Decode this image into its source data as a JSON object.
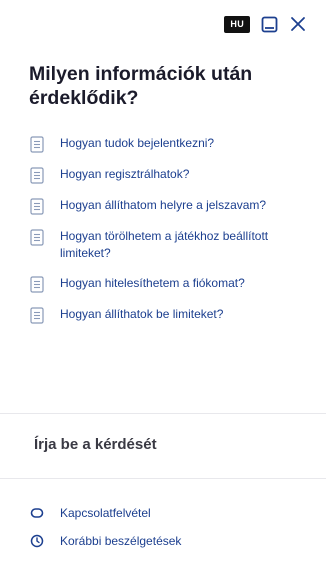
{
  "header": {
    "language_badge": "HU"
  },
  "main": {
    "heading": "Milyen információk után érdeklődik?",
    "faq_items": [
      {
        "label": "Hogyan tudok bejelentkezni?"
      },
      {
        "label": "Hogyan regisztrálhatok?"
      },
      {
        "label": "Hogyan állíthatom helyre a jelszavam?"
      },
      {
        "label": "Hogyan törölhetem a játékhoz beállított limiteket?"
      },
      {
        "label": "Hogyan hitelesíthetem a fiókomat?"
      },
      {
        "label": "Hogyan állíthatok be limiteket?"
      }
    ]
  },
  "input": {
    "placeholder": "Írja be a kérdését"
  },
  "footer": {
    "contact_label": "Kapcsolatfelvétel",
    "history_label": "Korábbi beszélgetések"
  },
  "colors": {
    "link": "#1c3f8f",
    "icon": "#1c3f8f",
    "doc_icon": "#8a9ab8",
    "badge_bg": "#111111"
  }
}
